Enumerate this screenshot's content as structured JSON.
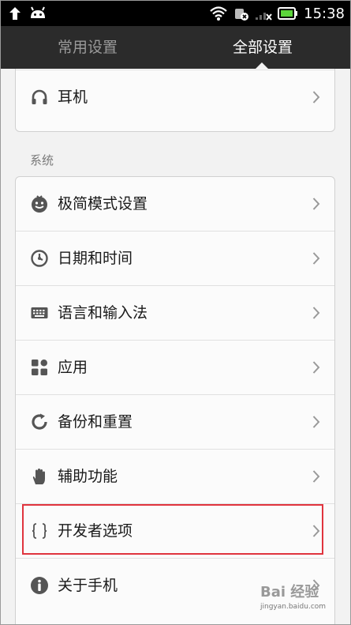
{
  "status_bar": {
    "time": "15:38",
    "icons": [
      "upload-arrow-icon",
      "android-icon",
      "wifi-icon",
      "data-off-icon",
      "signal-off-icon",
      "battery-icon"
    ]
  },
  "tabs": [
    {
      "label": "常用设置",
      "active": false
    },
    {
      "label": "全部设置",
      "active": true
    }
  ],
  "top_card": {
    "items": [
      {
        "label": "耳机",
        "icon": "headphones-icon"
      }
    ]
  },
  "system_section": {
    "title": "系统",
    "items": [
      {
        "label": "极简模式设置",
        "icon": "simple-mode-icon"
      },
      {
        "label": "日期和时间",
        "icon": "clock-icon"
      },
      {
        "label": "语言和输入法",
        "icon": "keyboard-icon"
      },
      {
        "label": "应用",
        "icon": "apps-icon"
      },
      {
        "label": "备份和重置",
        "icon": "backup-icon"
      },
      {
        "label": "辅助功能",
        "icon": "hand-icon"
      },
      {
        "label": "开发者选项",
        "icon": "braces-icon"
      },
      {
        "label": "关于手机",
        "icon": "info-icon"
      }
    ]
  },
  "watermark": {
    "logo": "Bai 经验",
    "url": "jingyan.baidu.com"
  },
  "colors": {
    "highlight": "#e0343e",
    "tabbar": "#2b2b2b",
    "icon": "#555555"
  }
}
